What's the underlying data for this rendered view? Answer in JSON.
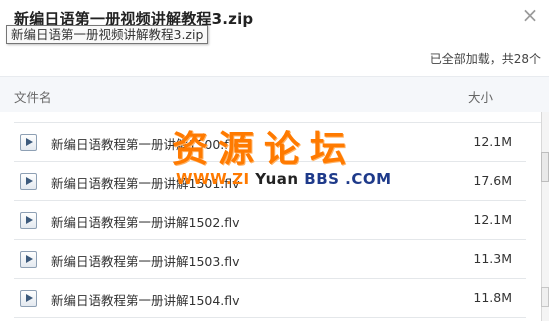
{
  "header": {
    "title": "新编日语第一册视频讲解教程3.zip",
    "tooltip": "新编日语第一册视频讲解教程3.zip",
    "close_glyph": "×",
    "summary": "已全部加载，共28个"
  },
  "columns": {
    "name": "文件名",
    "size": "大小"
  },
  "files": [
    {
      "name": "新编日语教程第一册讲解1500.flv",
      "size": "12.1M",
      "icon": "video-file-icon"
    },
    {
      "name": "新编日语教程第一册讲解1501.flv",
      "size": "17.6M",
      "icon": "video-file-icon"
    },
    {
      "name": "新编日语教程第一册讲解1502.flv",
      "size": "12.1M",
      "icon": "video-file-icon"
    },
    {
      "name": "新编日语教程第一册讲解1503.flv",
      "size": "11.3M",
      "icon": "video-file-icon"
    },
    {
      "name": "新编日语教程第一册讲解1504.flv",
      "size": "11.8M",
      "icon": "video-file-icon"
    }
  ],
  "watermark": {
    "chinese": "资源论坛",
    "url_part1": "WWW.ZI",
    "url_part2": " Yuan",
    "url_part3": " BBS .COM"
  },
  "colors": {
    "watermark_orange": "#ff7a00",
    "watermark_blue": "#1e3a8a",
    "icon_blue": "#3c5a7c"
  }
}
